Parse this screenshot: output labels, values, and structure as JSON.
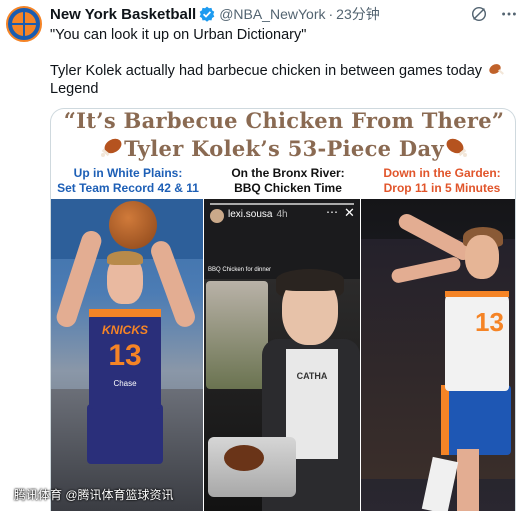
{
  "account": {
    "name": "New York Basketball",
    "handle": "@NBA_NewYork",
    "time": "23分钟",
    "avatar_text": "NEW YORK BASKETBALL"
  },
  "tweet": {
    "line1": "\"You can look it up on Urban Dictionary\"",
    "line2": "Tyler Kolek actually had barbecue chicken in between games today",
    "line3": "Legend"
  },
  "graphic": {
    "title1": "“It’s Barbecue Chicken From There”",
    "title2": "Tyler Kolek’s 53-Piece Day",
    "cap1_a": "Up in White Plains:",
    "cap1_b": "Set Team Record 42 & 11",
    "cap2_a": "On the Bronx River:",
    "cap2_b": "BBQ Chicken Time",
    "cap3_a": "Down in the Garden:",
    "cap3_b": "Drop 11 in 5 Minutes",
    "jersey_team": "KNICKS",
    "jersey_number": "13",
    "jersey_sponsor": "Chase",
    "story_user": "lexi.sousa",
    "story_time": "4h",
    "story_caption": "BBQ Chicken for dinner",
    "shirt_text": "CATHA",
    "right_number": "13"
  },
  "watermark": "腾讯体育 @腾讯体育篮球资讯",
  "colors": {
    "title_brown": "#8a6a52",
    "cap_blue": "#1d5fb6",
    "cap_orange": "#e1552b",
    "verified_blue": "#1d9bf0",
    "knicks_orange": "#f58426"
  }
}
